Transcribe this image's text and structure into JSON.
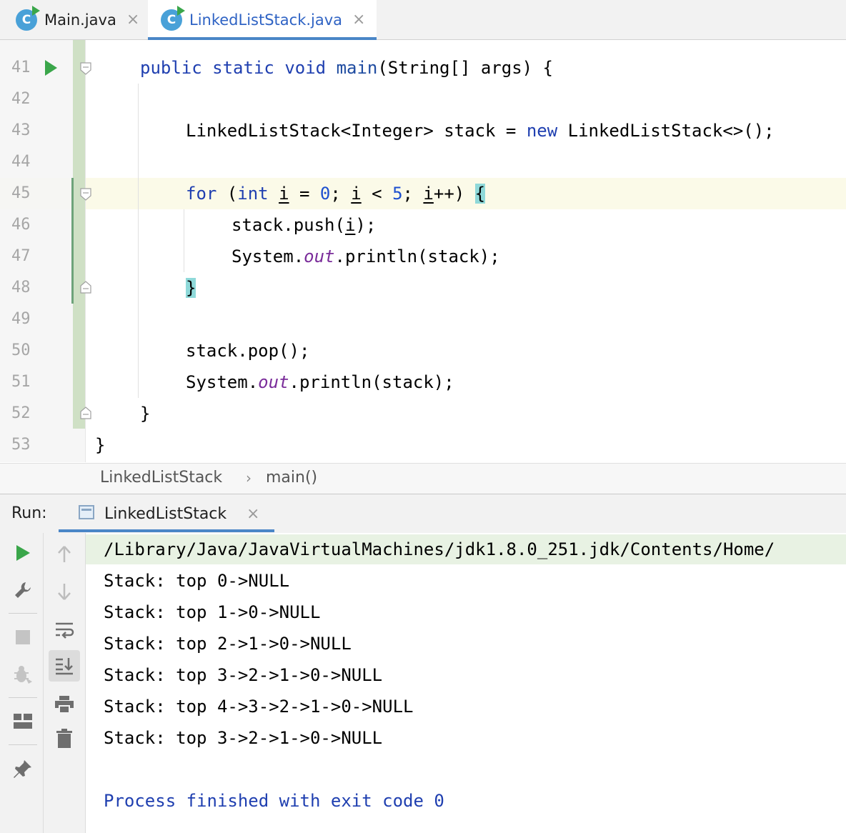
{
  "tabs": [
    {
      "label": "Main.java",
      "icon_letter": "C",
      "active": false
    },
    {
      "label": "LinkedListStack.java",
      "icon_letter": "C",
      "active": true
    }
  ],
  "editor": {
    "line_numbers": [
      "41",
      "42",
      "43",
      "44",
      "45",
      "46",
      "47",
      "48",
      "49",
      "50",
      "51",
      "52",
      "53"
    ],
    "lines": {
      "l41": {
        "kw1": "public",
        "kw2": "static",
        "kw3": "void",
        "fn": "main",
        "rest": "(String[] args) {"
      },
      "l43": {
        "a": "LinkedListStack<Integer> stack = ",
        "kw": "new",
        "b": " LinkedListStack<>();"
      },
      "l45": {
        "kw1": "for",
        "p1": " (",
        "kw2": "int",
        "p2": " ",
        "v1": "i",
        "p3": " = ",
        "n1": "0",
        "p4": "; ",
        "v2": "i",
        "p5": " < ",
        "n2": "5",
        "p6": "; ",
        "v3": "i",
        "p7": "++) ",
        "brace": "{"
      },
      "l46": {
        "a": "stack.push(",
        "v": "i",
        "b": ");"
      },
      "l47": {
        "a": "System.",
        "fld": "out",
        "b": ".println(stack);"
      },
      "l48": {
        "brace": "}"
      },
      "l50": {
        "text": "stack.pop();"
      },
      "l51": {
        "a": "System.",
        "fld": "out",
        "b": ".println(stack);"
      },
      "l52": {
        "text": "}"
      },
      "l53": {
        "text": "}"
      }
    }
  },
  "breadcrumb": {
    "class_name": "LinkedListStack",
    "separator": "›",
    "method": "main()"
  },
  "run_panel": {
    "label": "Run:",
    "tab_title": "LinkedListStack",
    "tab_close": "×",
    "command_line": "/Library/Java/JavaVirtualMachines/jdk1.8.0_251.jdk/Contents/Home/",
    "output_lines": [
      "Stack: top 0->NULL",
      "Stack: top 1->0->NULL",
      "Stack: top 2->1->0->NULL",
      "Stack: top 3->2->1->0->NULL",
      "Stack: top 4->3->2->1->0->NULL",
      "Stack: top 3->2->1->0->NULL"
    ],
    "exit_message": "Process finished with exit code 0"
  },
  "icons": {
    "run": "play-icon",
    "settings": "wrench-icon",
    "stop": "stop-icon",
    "debug": "bug-icon",
    "layout": "layout-icon",
    "pin": "pin-icon",
    "up": "arrow-up-icon",
    "down": "arrow-down-icon",
    "wrap": "soft-wrap-icon",
    "scroll": "scroll-to-end-icon",
    "print": "print-icon",
    "trash": "trash-icon"
  },
  "colors": {
    "keyword": "#1f3fb0",
    "number": "#1d4fcf",
    "field": "#7a2c9a",
    "run_green": "#3aa64a",
    "accent": "#4a86c7"
  }
}
